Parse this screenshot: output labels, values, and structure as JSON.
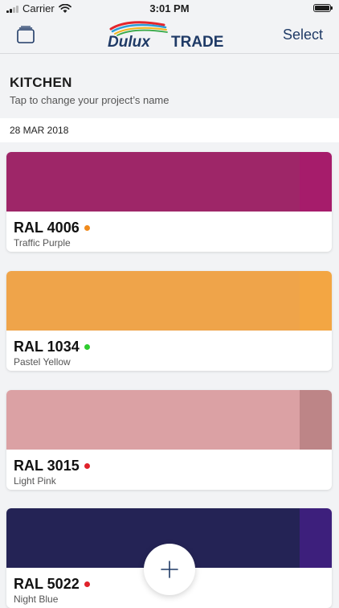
{
  "status_bar": {
    "carrier": "Carrier",
    "time": "3:01 PM"
  },
  "nav": {
    "logo_text": "Dulux",
    "logo_trade": "TRADE",
    "select_label": "Select"
  },
  "project": {
    "title": "KITCHEN",
    "hint": "Tap to change your project’s name"
  },
  "date_label": "28 MAR 2018",
  "colors": {
    "brand": "#1f3a66",
    "background": "#f2f3f5"
  },
  "cards": [
    {
      "code": "RAL 4006",
      "name": "Traffic Purple",
      "swatch": "#9e2668",
      "edge": "#a61c6b",
      "dot": "#f08a1c"
    },
    {
      "code": "RAL 1034",
      "name": "Pastel Yellow",
      "swatch": "#efa44a",
      "edge": "#f3a643",
      "dot": "#2ecc2e"
    },
    {
      "code": "RAL 3015",
      "name": "Light Pink",
      "swatch": "#dba1a4",
      "edge": "#bd8587",
      "dot": "#e0222a"
    },
    {
      "code": "RAL 5022",
      "name": "Night Blue",
      "swatch": "#242355",
      "edge": "#3d1f7c",
      "dot": "#e0222a"
    }
  ],
  "icons": {
    "projects": "projects-stack-icon",
    "add": "plus-icon",
    "wifi": "wifi-icon",
    "battery": "battery-icon",
    "signal": "signal-icon"
  }
}
